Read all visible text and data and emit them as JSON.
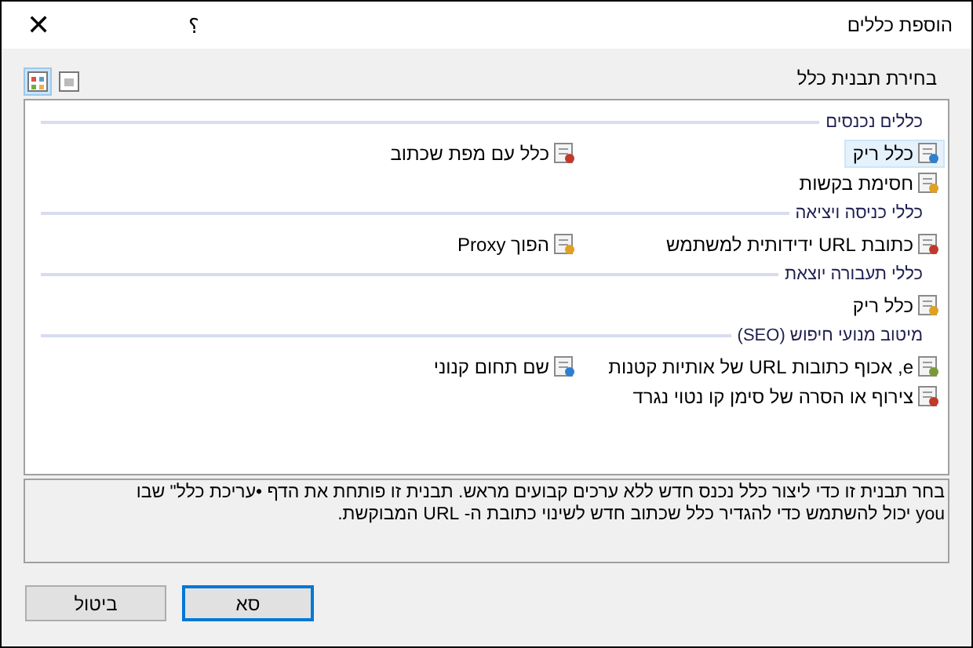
{
  "window": {
    "title": "הוספת כללים",
    "help": "؟",
    "close": "✕"
  },
  "template_label": "בחירת תבנית כלל",
  "view_buttons": [
    {
      "kind": "large",
      "selected": true
    },
    {
      "kind": "small",
      "selected": false
    }
  ],
  "groups": [
    {
      "heading": "כללים נכנסים",
      "items": [
        {
          "label": "כלל ריק",
          "selected": true
        },
        {
          "label": "כלל עם מפת שכתוב",
          "selected": false
        },
        {
          "label": "חסימת בקשות",
          "selected": false
        }
      ]
    },
    {
      "heading": "כללי כניסה ויציאה",
      "items": [
        {
          "label": "כתובת URL ידידותית למשתמש",
          "selected": false
        },
        {
          "label": "הפוך Proxy",
          "selected": false
        }
      ]
    },
    {
      "heading": "כללי תעבורה יוצאת",
      "items": [
        {
          "label": "כלל ריק",
          "selected": false
        }
      ]
    },
    {
      "heading": "מיטוב מנועי חיפוש (SEO)",
      "items": [
        {
          "label": "e, אכוף כתובות URL של אותיות קטנות",
          "selected": false
        },
        {
          "label": "שם תחום קנוני",
          "selected": false
        },
        {
          "label": "צירוף או הסרה של סימן קו נטוי נגרד",
          "selected": false
        }
      ]
    }
  ],
  "description": [
    "בחר תבנית זו כדי ליצור כלל נכנס חדש ללא ערכים קבועים מראש. תבנית זו פותחת את הדף •עריכת כלל\" שבו",
    "you יכול להשתמש כדי להגדיר כלל שכתוב חדש לשינוי כתובת ה- URL המבוקשת."
  ],
  "buttons": [
    {
      "label": "סא",
      "default": true
    },
    {
      "label": "ביטול",
      "default": false
    }
  ]
}
